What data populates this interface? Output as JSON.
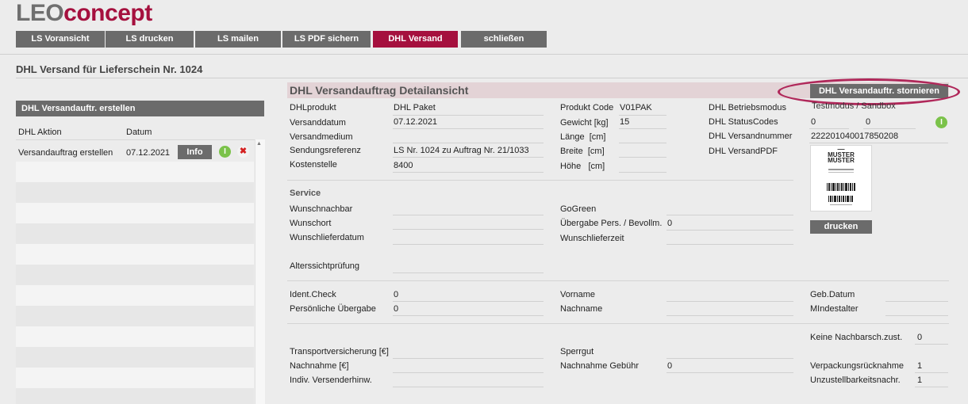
{
  "logo": {
    "part1": "LEO",
    "part2": "concept"
  },
  "tabs": [
    "LS Voransicht",
    "LS drucken",
    "LS mailen",
    "LS PDF sichern",
    "DHL Versand",
    "schließen"
  ],
  "page_title": "DHL Versand für Lieferschein Nr. 1024",
  "left": {
    "header": "DHL Versandauftr. erstellen",
    "col_aktion": "DHL Aktion",
    "col_datum": "Datum",
    "row": {
      "aktion": "Versandauftrag erstellen",
      "datum": "07.12.2021",
      "info": "Info"
    }
  },
  "detail": {
    "title": "DHL Versandauftrag Detailansicht",
    "storno_button": "DHL Versandauftr. stornieren",
    "dhlprodukt_label": "DHLprodukt",
    "dhlprodukt_value": "DHL Paket",
    "versanddatum_label": "Versanddatum",
    "versanddatum_value": "07.12.2021",
    "versandmedium_label": "Versandmedium",
    "sendungsreferenz_label": "Sendungsreferenz",
    "sendungsreferenz_value": "LS Nr. 1024 zu Auftrag Nr. 21/1033",
    "kostenstelle_label": "Kostenstelle",
    "kostenstelle_value": "8400",
    "produktcode_label": "Produkt Code",
    "produktcode_value": "V01PAK",
    "gewicht_label": "Gewicht [kg]",
    "gewicht_value": "15",
    "laenge_label": "Länge  [cm]",
    "breite_label": "Breite  [cm]",
    "hoehe_label": "Höhe   [cm]",
    "betriebsmodus_label": "DHL Betriebsmodus",
    "betriebsmodus_value": "Testmodus / Sandbox",
    "statuscodes_label": "DHL StatusCodes",
    "status1": "0",
    "status2": "0",
    "versandnummer_label": "DHL Versandnummer",
    "versandnummer_value": "222201040017850208",
    "versandpdf_label": "DHL VersandPDF",
    "label_text1": "MUSTER",
    "label_text2": "MUSTER",
    "drucken_button": "drucken"
  },
  "service": {
    "title": "Service",
    "wunschnachbar": "Wunschnachbar",
    "wunschort": "Wunschort",
    "wunschlieferdatum": "Wunschlieferdatum",
    "alterssicht": "Alterssichtprüfung",
    "gogreen": "GoGreen",
    "uebergabe_label": "Übergabe Pers. / Bevollm.",
    "uebergabe_value": "0",
    "wunschlieferzeit": "Wunschlieferzeit"
  },
  "ident": {
    "identcheck_label": "Ident.Check",
    "identcheck_value": "0",
    "persoenlich_label": "Persönliche Übergabe",
    "persoenlich_value": "0",
    "vorname": "Vorname",
    "nachname": "Nachname",
    "gebdatum": "Geb.Datum",
    "mindestalter": "MIndestalter"
  },
  "extra": {
    "keine_nachbar_label": "Keine Nachbarsch.zust.",
    "keine_nachbar_value": "0",
    "transport_label": "Transportversicherung [€]",
    "nachnahme_label": "Nachnahme [€]",
    "indiv_label": "Indiv. Versenderhinw.",
    "sperrgut": "Sperrgut",
    "nachnahmegebuehr_label": "Nachnahme Gebühr",
    "nachnahmegebuehr_value": "0",
    "verpackung_label": "Verpackungsrücknahme",
    "verpackung_value": "1",
    "unzustellbar_label": "Unzustellbarkeitsnachr.",
    "unzustellbar_value": "1"
  }
}
